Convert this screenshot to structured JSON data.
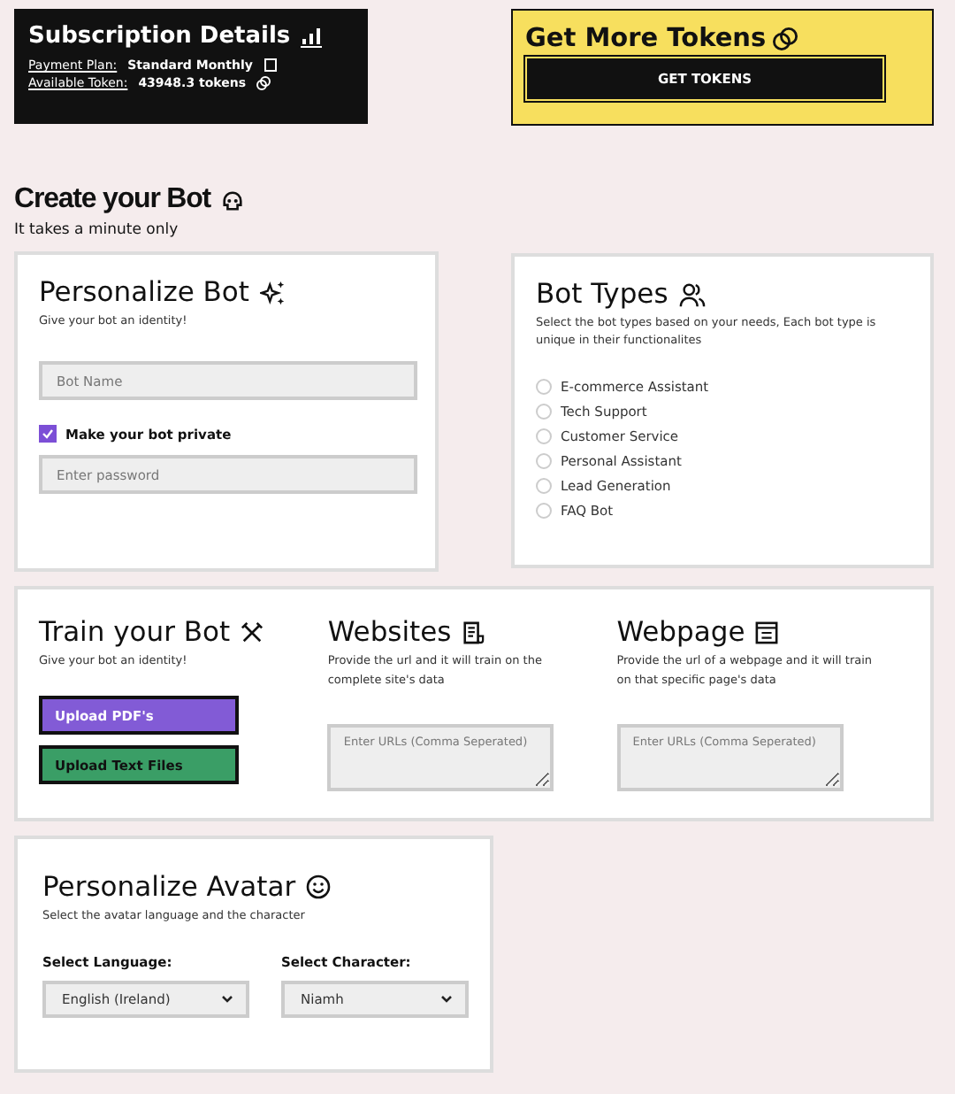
{
  "subscription": {
    "title": "Subscription Details",
    "rows": [
      {
        "label": "Payment Plan:",
        "value": "Standard Monthly"
      },
      {
        "label": "Available Token:",
        "value": "43948.3 tokens"
      }
    ]
  },
  "tokens": {
    "title": "Get More Tokens",
    "button": "GET TOKENS"
  },
  "create": {
    "title": "Create your Bot",
    "subtitle": "It takes a minute only"
  },
  "personalize_bot": {
    "title": "Personalize Bot",
    "subtitle": "Give your bot an identity!",
    "name_placeholder": "Bot Name",
    "private_label": "Make your bot private",
    "private_checked": true,
    "password_placeholder": "Enter password"
  },
  "bot_types": {
    "title": "Bot Types",
    "subtitle": "Select the bot types based on your needs, Each bot type is unique in their functionalites",
    "options": [
      {
        "label": "E-commerce Assistant",
        "selected": false
      },
      {
        "label": "Tech Support",
        "selected": false
      },
      {
        "label": "Customer Service",
        "selected": false
      },
      {
        "label": "Personal Assistant",
        "selected": false
      },
      {
        "label": "Lead Generation",
        "selected": false
      },
      {
        "label": "FAQ Bot",
        "selected": false
      }
    ]
  },
  "train": {
    "title": "Train your Bot",
    "subtitle": "Give your bot an identity!",
    "buttons": [
      {
        "label": "Upload PDF's",
        "color": "#825bd6"
      },
      {
        "label": "Upload Text Files",
        "color": "#3a9e66"
      }
    ]
  },
  "websites": {
    "title": "Websites",
    "subtitle": "Provide the url and it will train on the complete site's data",
    "placeholder": "Enter URLs (Comma Seperated)"
  },
  "webpage": {
    "title": "Webpage",
    "subtitle": "Provide the url of a webpage and it will train on that specific page's data",
    "placeholder": "Enter URLs (Comma Seperated)"
  },
  "avatar": {
    "title": "Personalize Avatar",
    "subtitle": "Select the avatar language and the character",
    "language_label": "Select Language:",
    "language": "English (Ireland)",
    "character_label": "Select Character:",
    "character": "Niamh"
  }
}
